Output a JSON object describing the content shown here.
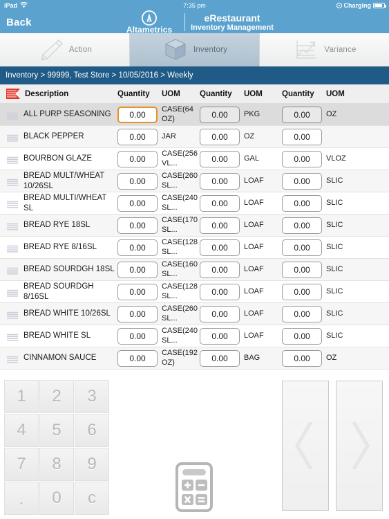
{
  "status_bar": {
    "device": "iPad",
    "wifi_icon": "wifi-icon",
    "time": "7:35 pm",
    "charging_label": "Charging",
    "battery_icon": "battery-icon"
  },
  "title_bar": {
    "back_label": "Back",
    "logo_icon": "altametrics-logo-icon",
    "brand_name": "Altametrics",
    "app_title": "eRestaurant",
    "app_subtitle": "Inventory Management",
    "background_color": "#5ba3ce"
  },
  "tabs": [
    {
      "label": "Action",
      "icon": "pencil-icon",
      "active": false
    },
    {
      "label": "Inventory",
      "icon": "box-icon",
      "active": true
    },
    {
      "label": "Variance",
      "icon": "line-chart-icon",
      "active": false
    }
  ],
  "breadcrumb": {
    "text": "Inventory > 99999, Test Store > 10/05/2016 > Weekly",
    "background_color": "#1f5b86"
  },
  "table": {
    "flag_icon": "red-flag-icon",
    "headers": {
      "description": "Description",
      "quantity1": "Quantity",
      "uom1": "UOM",
      "quantity2": "Quantity",
      "uom2": "UOM",
      "quantity3": "Quantity",
      "uom3": "UOM"
    },
    "rows": [
      {
        "grip_icon": "drag-handle-icon",
        "description": "ALL PURP SEASONING",
        "qty1": "0.00",
        "uom1": "CASE(64 OZ)",
        "qty2": "0.00",
        "uom2": "PKG",
        "qty3": "0.00",
        "uom3": "OZ",
        "selected": true,
        "focused_field": "qty1"
      },
      {
        "grip_icon": "drag-handle-icon",
        "description": "BLACK PEPPER",
        "qty1": "0.00",
        "uom1": "JAR",
        "qty2": "0.00",
        "uom2": "OZ",
        "qty3": "0.00",
        "uom3": "",
        "selected": false,
        "focused_field": ""
      },
      {
        "grip_icon": "drag-handle-icon",
        "description": "BOURBON GLAZE",
        "qty1": "0.00",
        "uom1": "CASE(256 VL...",
        "qty2": "0.00",
        "uom2": "GAL",
        "qty3": "0.00",
        "uom3": "VLOZ",
        "selected": false,
        "focused_field": ""
      },
      {
        "grip_icon": "drag-handle-icon",
        "description": "BREAD MULT/WHEAT 10/26SL",
        "qty1": "0.00",
        "uom1": "CASE(260 SL...",
        "qty2": "0.00",
        "uom2": "LOAF",
        "qty3": "0.00",
        "uom3": "SLIC",
        "selected": false,
        "focused_field": ""
      },
      {
        "grip_icon": "drag-handle-icon",
        "description": "BREAD MULTI/WHEAT SL",
        "qty1": "0.00",
        "uom1": "CASE(240 SL...",
        "qty2": "0.00",
        "uom2": "LOAF",
        "qty3": "0.00",
        "uom3": "SLIC",
        "selected": false,
        "focused_field": ""
      },
      {
        "grip_icon": "drag-handle-icon",
        "description": "BREAD RYE 18SL",
        "qty1": "0.00",
        "uom1": "CASE(170 SL...",
        "qty2": "0.00",
        "uom2": "LOAF",
        "qty3": "0.00",
        "uom3": "SLIC",
        "selected": false,
        "focused_field": ""
      },
      {
        "grip_icon": "drag-handle-icon",
        "description": "BREAD RYE 8/16SL",
        "qty1": "0.00",
        "uom1": "CASE(128 SL...",
        "qty2": "0.00",
        "uom2": "LOAF",
        "qty3": "0.00",
        "uom3": "SLIC",
        "selected": false,
        "focused_field": ""
      },
      {
        "grip_icon": "drag-handle-icon",
        "description": "BREAD SOURDGH 18SL",
        "qty1": "0.00",
        "uom1": "CASE(160 SL...",
        "qty2": "0.00",
        "uom2": "LOAF",
        "qty3": "0.00",
        "uom3": "SLIC",
        "selected": false,
        "focused_field": ""
      },
      {
        "grip_icon": "drag-handle-icon",
        "description": "BREAD SOURDGH 8/16SL",
        "qty1": "0.00",
        "uom1": "CASE(128 SL...",
        "qty2": "0.00",
        "uom2": "LOAF",
        "qty3": "0.00",
        "uom3": "SLIC",
        "selected": false,
        "focused_field": ""
      },
      {
        "grip_icon": "drag-handle-icon",
        "description": "BREAD WHITE 10/26SL",
        "qty1": "0.00",
        "uom1": "CASE(260 SL...",
        "qty2": "0.00",
        "uom2": "LOAF",
        "qty3": "0.00",
        "uom3": "SLIC",
        "selected": false,
        "focused_field": ""
      },
      {
        "grip_icon": "drag-handle-icon",
        "description": "BREAD WHITE SL",
        "qty1": "0.00",
        "uom1": "CASE(240 SL...",
        "qty2": "0.00",
        "uom2": "LOAF",
        "qty3": "0.00",
        "uom3": "SLIC",
        "selected": false,
        "focused_field": ""
      },
      {
        "grip_icon": "drag-handle-icon",
        "description": "CINNAMON SAUCE",
        "qty1": "0.00",
        "uom1": "CASE(192 OZ)",
        "qty2": "0.00",
        "uom2": "BAG",
        "qty3": "0.00",
        "uom3": "OZ",
        "selected": false,
        "focused_field": ""
      }
    ]
  },
  "keypad": {
    "keys": [
      "1",
      "2",
      "3",
      "4",
      "5",
      "6",
      "7",
      "8",
      "9",
      ".",
      "0",
      "c"
    ]
  },
  "calculator": {
    "icon": "calculator-icon"
  },
  "navigation": {
    "prev_icon": "chevron-left-icon",
    "next_icon": "chevron-right-icon"
  },
  "colors": {
    "accent_blue": "#5ba3ce",
    "breadcrumb_blue": "#1f5b86",
    "focus_orange": "#e8912c",
    "flag_red": "#e5332a"
  }
}
